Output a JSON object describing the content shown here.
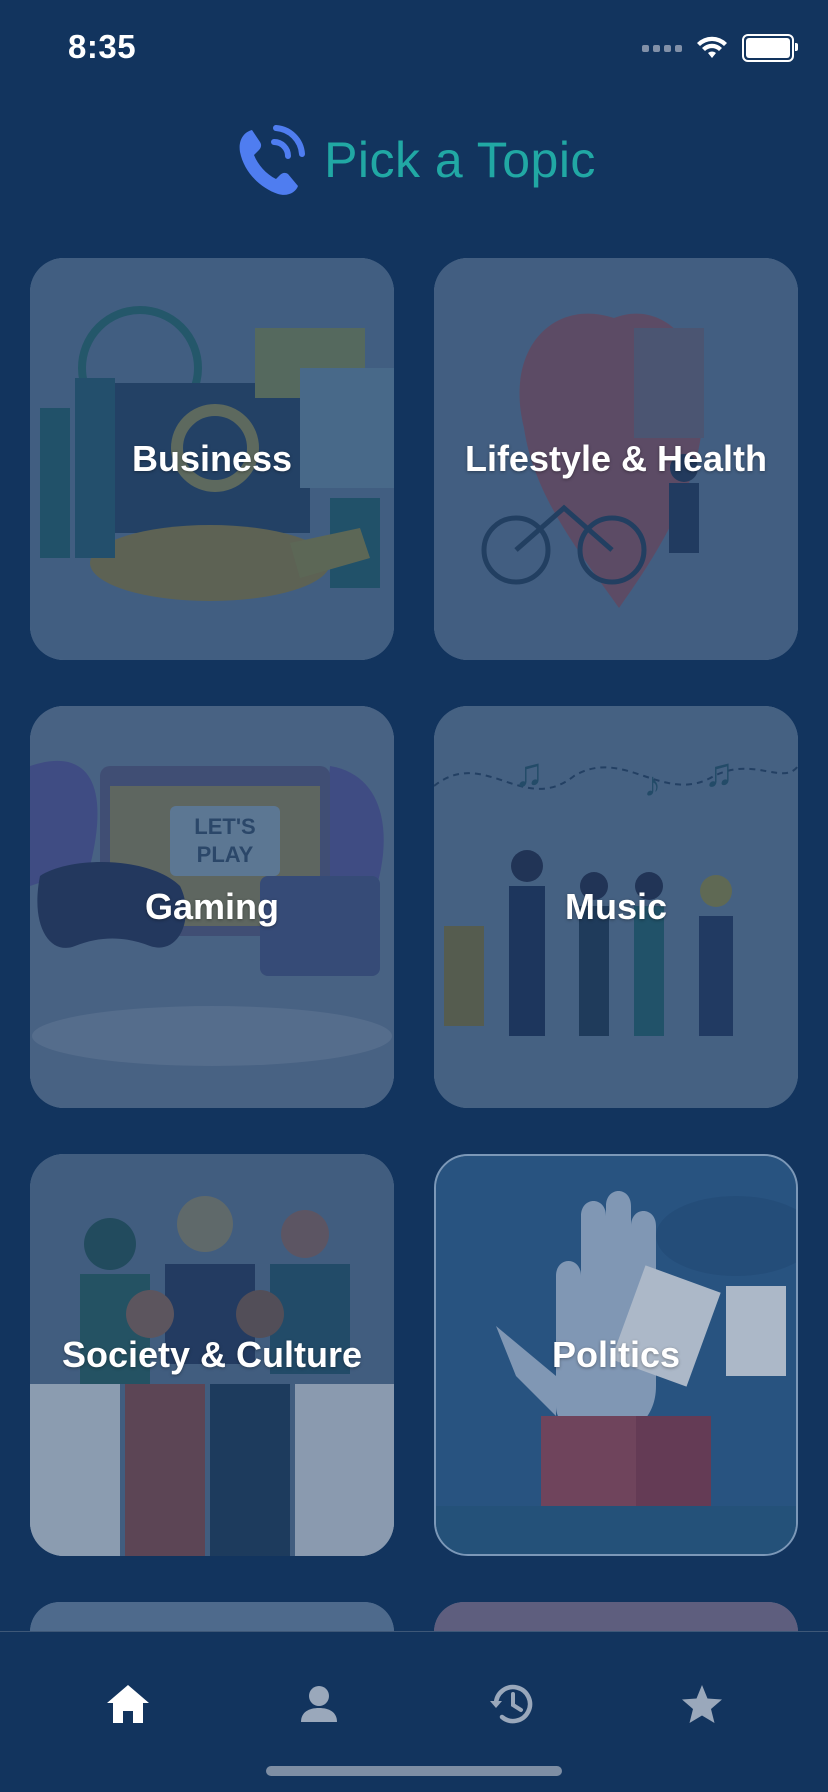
{
  "status": {
    "time": "8:35"
  },
  "header": {
    "title": "Pick a Topic",
    "icon": "phone-call-icon",
    "accent": "#21a8a4",
    "icon_color": "#4f7df0"
  },
  "topics": [
    {
      "label": "Business"
    },
    {
      "label": "Lifestyle & Health"
    },
    {
      "label": "Gaming"
    },
    {
      "label": "Music"
    },
    {
      "label": "Society & Culture"
    },
    {
      "label": "Politics"
    }
  ],
  "tabbar": {
    "tabs": [
      {
        "icon": "home-icon",
        "active": true
      },
      {
        "icon": "profile-icon",
        "active": false
      },
      {
        "icon": "history-icon",
        "active": false
      },
      {
        "icon": "star-icon",
        "active": false
      }
    ],
    "active_color": "#ffffff",
    "inactive_color": "#9aa8bb"
  },
  "colors": {
    "background": "#12345e"
  }
}
